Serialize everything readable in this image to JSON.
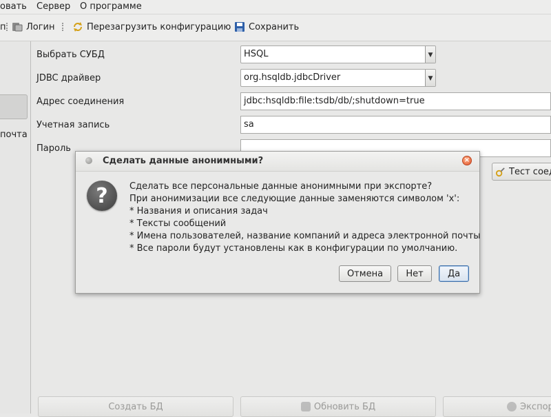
{
  "menubar": {
    "items": [
      "овать",
      "Сервер",
      "О программе"
    ]
  },
  "toolbar": {
    "partial_label": "п",
    "login_label": "Логин",
    "reload_label": "Перезагрузить конфигурацию",
    "save_label": "Сохранить"
  },
  "left_pane": {
    "partial_label": "почта"
  },
  "form": {
    "dbms_label": "Выбрать СУБД",
    "dbms_value": "HSQL",
    "driver_label": "JDBC драйвер",
    "driver_value": "org.hsqldb.jdbcDriver",
    "url_label": "Адрес соединения",
    "url_value": "jdbc:hsqldb:file:tsdb/db/;shutdown=true",
    "account_label": "Учетная запись",
    "account_value": "sa",
    "password_label": "Пароль",
    "password_value": "",
    "test_button_label": "Тест соед"
  },
  "bottom_buttons": {
    "create_db": "Создать БД",
    "update_db": "Обновить БД",
    "export": "Экспор"
  },
  "dialog": {
    "title": "Сделать данные анонимными?",
    "lines": [
      "Сделать все персональные данные анонимными при экспорте?",
      "При анонимизации все следующие данные заменяются символом 'x':",
      "* Названия и описания задач",
      "* Тексты сообщений",
      "* Имена пользователей, название компаний и адреса электронной почты",
      "* Все пароли будут установлены как в конфигурации по умолчанию."
    ],
    "cancel_label": "Отмена",
    "no_label": "Нет",
    "yes_label": "Да",
    "close_glyph": "×",
    "question_glyph": "?"
  },
  "colors": {
    "default_button_border": "#3f6fa8",
    "close_button": "#e0532a",
    "window_bg": "#e8e8e7"
  }
}
